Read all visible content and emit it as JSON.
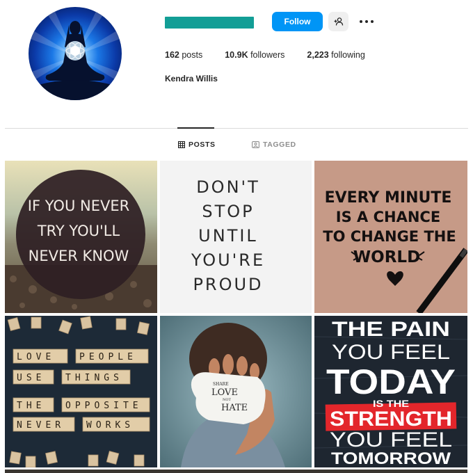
{
  "profile": {
    "follow_label": "Follow",
    "stats": {
      "posts_count": "162",
      "posts_label": "posts",
      "followers_count": "10.9K",
      "followers_label": "followers",
      "following_count": "2,223",
      "following_label": "following"
    },
    "display_name": "Kendra Willis",
    "username_redaction_color": "#139e96"
  },
  "tabs": [
    {
      "label": "POSTS",
      "icon": "grid-icon",
      "active": true
    },
    {
      "label": "TAGGED",
      "icon": "tag-icon",
      "active": false
    }
  ],
  "posts": [
    {
      "lines": [
        "IF YOU NEVER",
        "TRY YOU'LL",
        "NEVER KNOW"
      ]
    },
    {
      "lines": [
        "DON'T",
        "STOP",
        "UNTIL",
        "YOU'RE",
        "PROUD"
      ]
    },
    {
      "lines": [
        "EVERY MINUTE",
        "IS A CHANCE",
        "TO CHANGE THE",
        "WORLD"
      ]
    },
    {
      "lines": [
        "LOVE",
        "PEOPLE",
        "USE",
        "THINGS",
        "THE",
        "OPPOSITE",
        "NEVER",
        "WORKS"
      ]
    },
    {
      "lines": [
        "SHARE",
        "LOVE",
        "NOT",
        "HATE"
      ]
    },
    {
      "lines": [
        "THE PAIN",
        "YOU FEEL",
        "TODAY",
        "IS THE",
        "STRENGTH",
        "YOU FEEL",
        "TOMORROW"
      ]
    }
  ],
  "colors": {
    "follow_button": "#0095f6",
    "strength_banner": "#e3262b"
  }
}
